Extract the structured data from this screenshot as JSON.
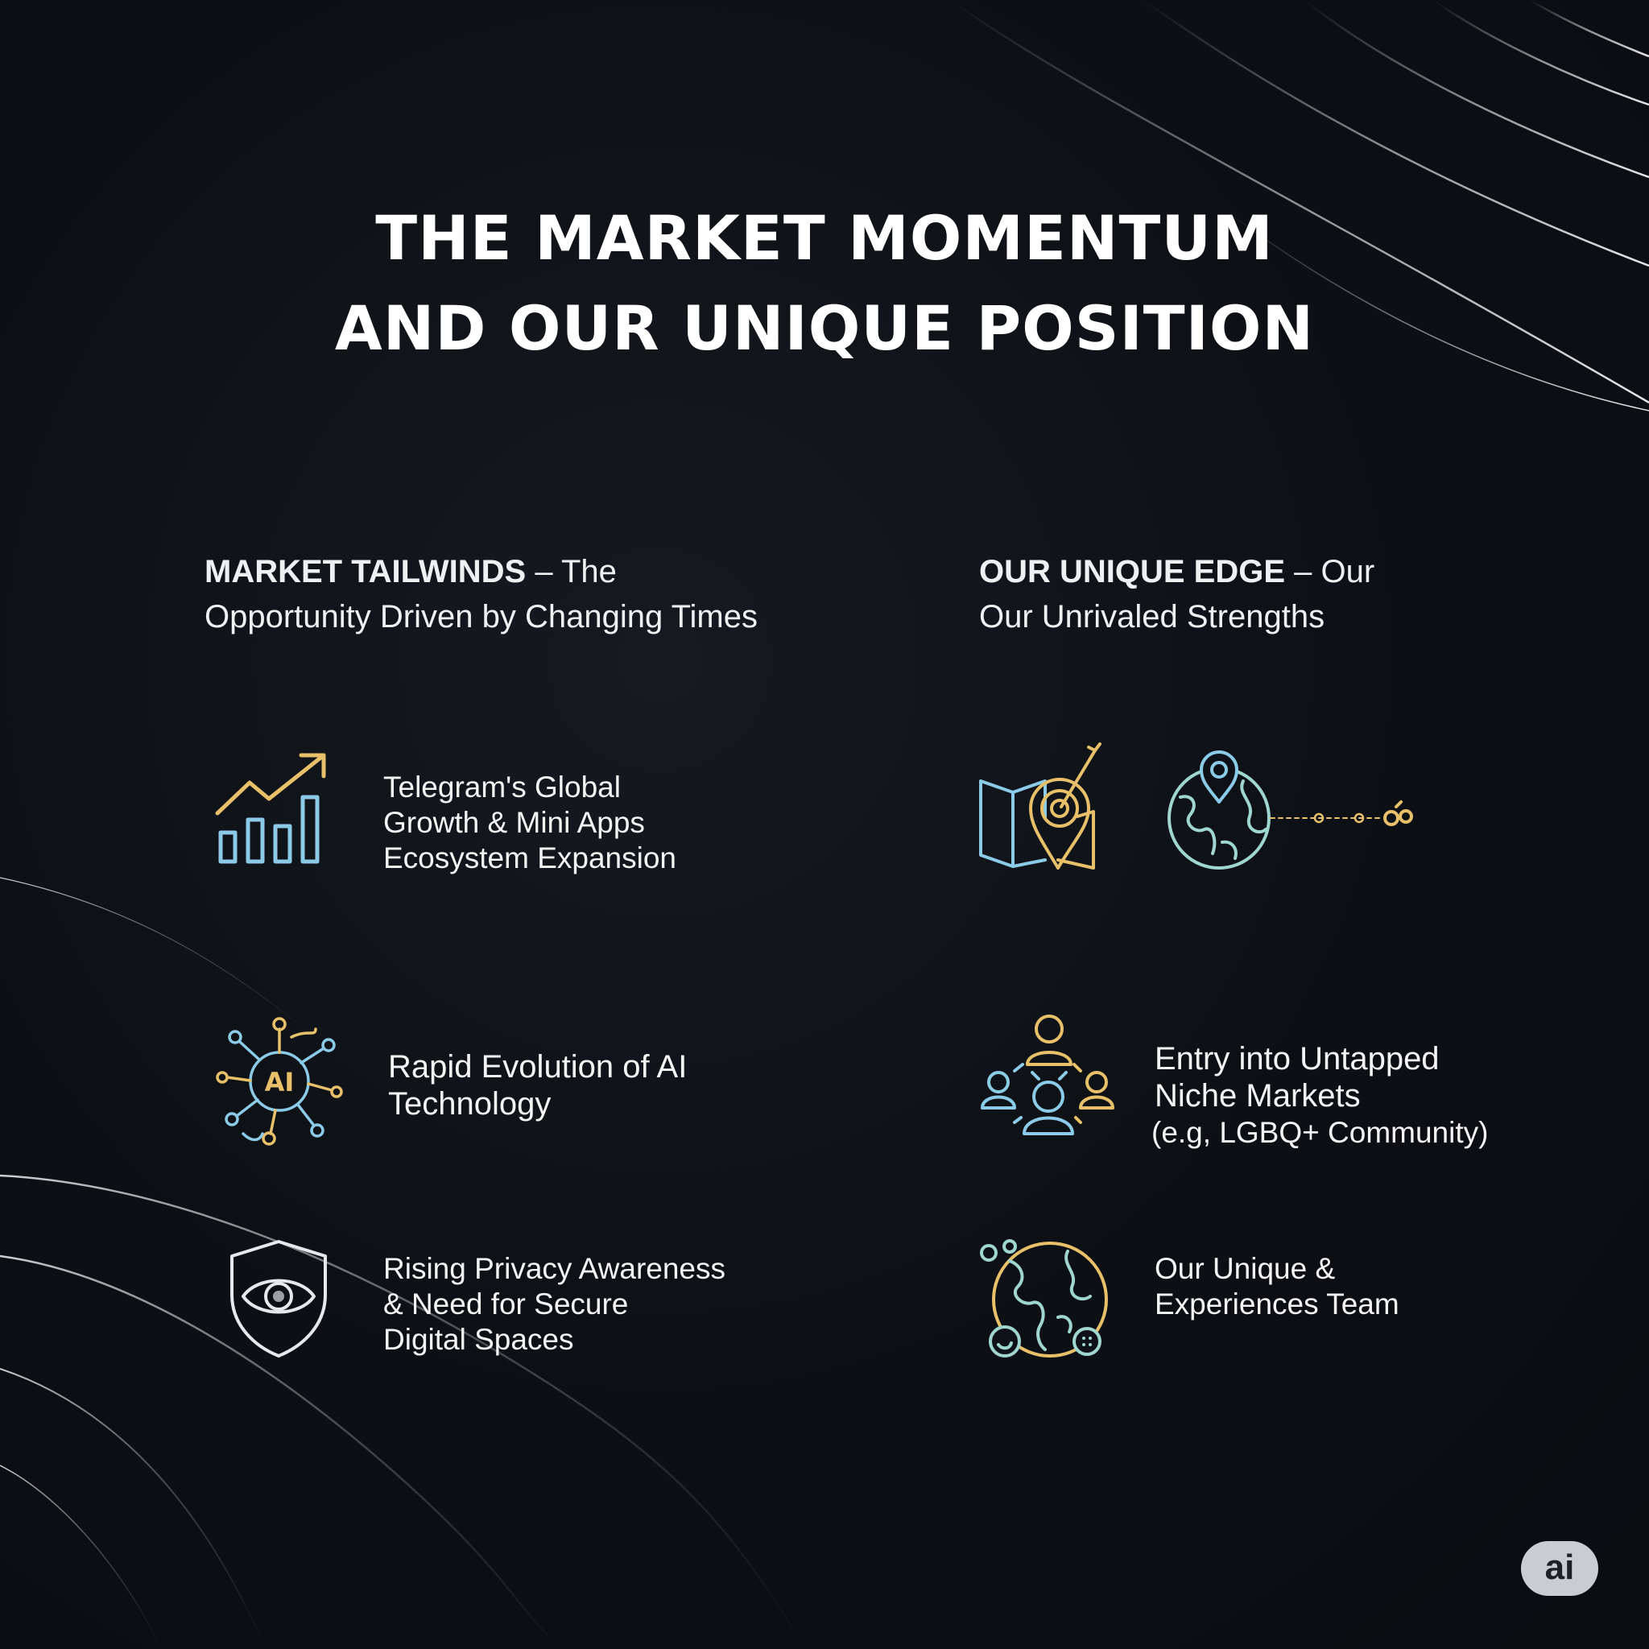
{
  "title": {
    "line1": "THE MARKET MOMENTUM",
    "line2": "AND OUR UNIQUE POSITION"
  },
  "left_column": {
    "heading_strong": "MARKET TAILWINDS",
    "heading_rest": " – The",
    "heading_line2": "Opportunity Driven by Changing Times",
    "items": [
      {
        "icon": "growth-chart-icon",
        "lines": [
          "Telegram's Global",
          "Growth & Mini Apps",
          "Ecosystem Expansion"
        ]
      },
      {
        "icon": "ai-network-icon",
        "icon_text": "AI",
        "lines": [
          "Rapid Evolution of AI",
          "Technology"
        ]
      },
      {
        "icon": "shield-eye-icon",
        "lines": [
          "Rising Privacy Awareness",
          "& Need for Secure",
          "Digital Spaces"
        ]
      }
    ]
  },
  "right_column": {
    "heading_strong": "OUR UNIQUE EDGE",
    "heading_rest": " – Our",
    "heading_line2": "Our Unrivaled Strengths",
    "items": [
      {
        "icons": [
          "map-target-icon",
          "globe-pin-icon"
        ]
      },
      {
        "icon": "community-people-icon",
        "lines": [
          "Entry into Untapped",
          "Niche Markets",
          "(e.g, LGBQ+ Community)"
        ]
      },
      {
        "icon": "globe-team-icon",
        "lines": [
          "Our Unique &",
          "Experiences Team"
        ]
      }
    ]
  },
  "badge": {
    "label": "ai"
  },
  "colors": {
    "background": "#0c0f14",
    "gold": "#e8c06a",
    "blue": "#8ccbe8",
    "teal": "#9fd6d0",
    "text": "#f4f4f4"
  }
}
